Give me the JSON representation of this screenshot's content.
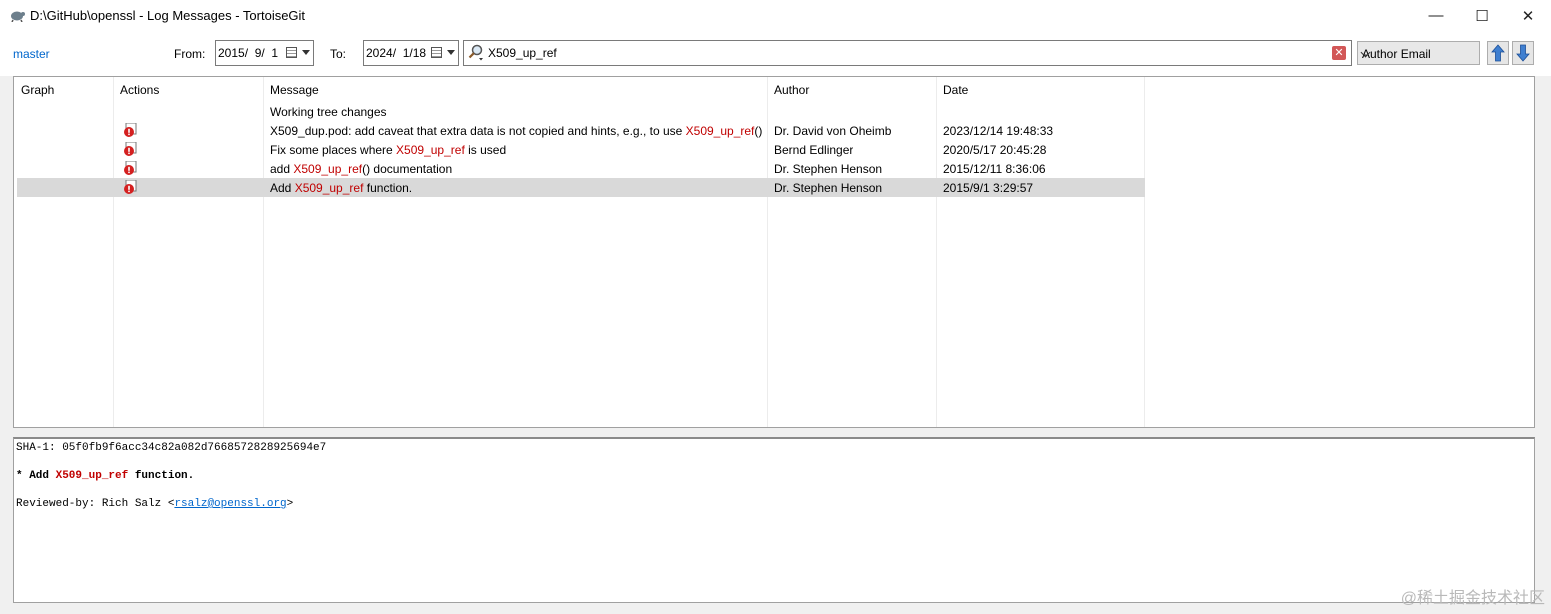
{
  "window": {
    "title": "D:\\GitHub\\openssl - Log Messages - TortoiseGit",
    "minimize_glyph": "—",
    "maximize_glyph": "☐",
    "close_glyph": "✕"
  },
  "toolbar": {
    "branch": "master",
    "from_label": "From:",
    "from_date": "2015/  9/  1",
    "to_label": "To:",
    "to_date": "2024/  1/18",
    "search_value": "X509_up_ref",
    "filter_field": "Author Email"
  },
  "table": {
    "columns": [
      "Graph",
      "Actions",
      "Message",
      "Author",
      "Date"
    ],
    "rows": [
      {
        "message_pre": "Working tree changes",
        "message_hl": "",
        "message_post": "",
        "author": "",
        "date": "",
        "has_icon": false
      },
      {
        "message_pre": "X509_dup.pod: add caveat that extra data is not copied and hints, e.g., to use ",
        "message_hl": "X509_up_ref",
        "message_post": "() i...",
        "author": "Dr. David von Oheimb",
        "date": "2023/12/14 19:48:33",
        "has_icon": true
      },
      {
        "message_pre": "Fix some places where ",
        "message_hl": "X509_up_ref",
        "message_post": " is used",
        "author": "Bernd Edlinger",
        "date": "2020/5/17 20:45:28",
        "has_icon": true
      },
      {
        "message_pre": "add ",
        "message_hl": "X509_up_ref",
        "message_post": "() documentation",
        "author": "Dr. Stephen Henson",
        "date": "2015/12/11 8:36:06",
        "has_icon": true
      },
      {
        "message_pre": "Add ",
        "message_hl": "X509_up_ref",
        "message_post": " function.",
        "author": "Dr. Stephen Henson",
        "date": "2015/9/1 3:29:57",
        "has_icon": true,
        "selected": true
      }
    ]
  },
  "detail": {
    "sha_line": "SHA-1: 05f0fb9f6acc34c82a082d7668572828925694e7",
    "subject_prefix": "* Add ",
    "subject_hl": "X509_up_ref",
    "subject_suffix": " function.",
    "reviewed_prefix": "Reviewed-by: Rich Salz <",
    "reviewed_email": "rsalz@openssl.org",
    "reviewed_suffix": ">"
  },
  "watermark": "@稀土掘金技术社区",
  "colors": {
    "highlight": "#c00000",
    "link": "#0066cc",
    "selection": "#d9d9d9"
  }
}
